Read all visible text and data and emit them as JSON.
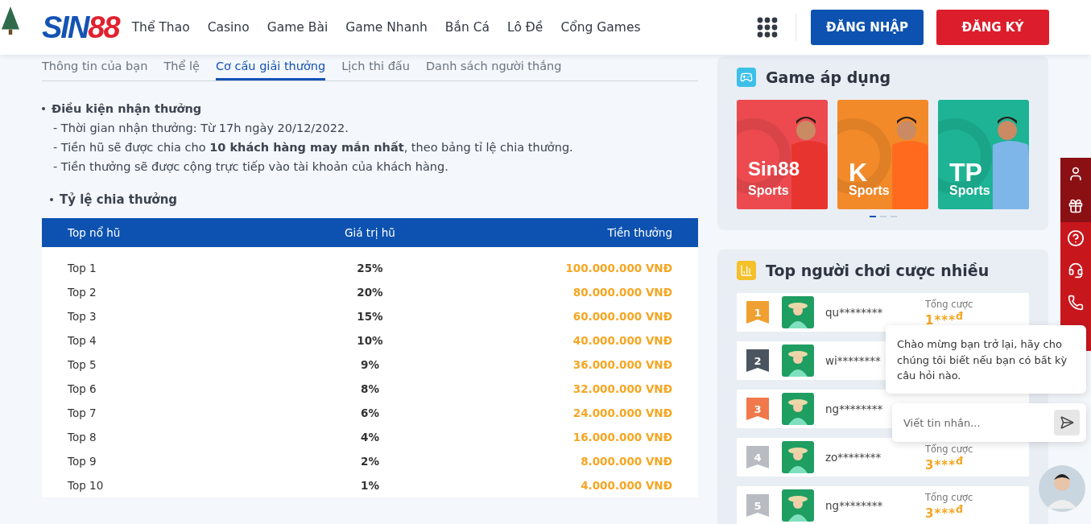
{
  "header": {
    "logo": {
      "part1": "SIN",
      "part2": "88"
    },
    "nav": [
      "Thể Thao",
      "Casino",
      "Game Bài",
      "Game Nhanh",
      "Bắn Cá",
      "Lô Đề",
      "Cổng Games"
    ],
    "login": "ĐĂNG NHẬP",
    "register": "ĐĂNG KÝ"
  },
  "tabs": [
    {
      "label": "Thông tin của bạn",
      "selected": false
    },
    {
      "label": "Thể lệ",
      "selected": false
    },
    {
      "label": "Cơ cấu giải thưởng",
      "selected": true
    },
    {
      "label": "Lịch thi đấu",
      "selected": false
    },
    {
      "label": "Danh sách người thắng",
      "selected": false
    }
  ],
  "conditions": {
    "title": "Điều kiện nhận thưởng",
    "lines": [
      "- Thời gian nhận thưởng: Từ 17h ngày 20/12/2022.",
      "- Tiền hũ sẽ được chia cho **10 khách hàng may mắn nhất**, theo bảng tỉ lệ chia thưởng.",
      "- Tiền thưởng sẽ được cộng trực tiếp vào tài khoản của khách hàng."
    ]
  },
  "ratio_title": "Tỷ lệ chia thưởng",
  "table": {
    "columns": [
      "Top nổ hũ",
      "Giá trị hũ",
      "Tiền thưởng"
    ],
    "rows": [
      [
        "Top 1",
        "25%",
        "100.000.000 VNĐ"
      ],
      [
        "Top 2",
        "20%",
        "80.000.000 VNĐ"
      ],
      [
        "Top 3",
        "15%",
        "60.000.000 VNĐ"
      ],
      [
        "Top 4",
        "10%",
        "40.000.000 VNĐ"
      ],
      [
        "Top 5",
        "9%",
        "36.000.000 VNĐ"
      ],
      [
        "Top 6",
        "8%",
        "32.000.000 VNĐ"
      ],
      [
        "Top 7",
        "6%",
        "24.000.000 VNĐ"
      ],
      [
        "Top 8",
        "4%",
        "16.000.000 VNĐ"
      ],
      [
        "Top 9",
        "2%",
        "8.000.000 VNĐ"
      ],
      [
        "Top 10",
        "1%",
        "4.000.000 VNĐ"
      ]
    ]
  },
  "games": {
    "title": "Game áp dụng",
    "cards": [
      {
        "name": "Sin88",
        "sub": "Sports",
        "color": "#ec4a4f"
      },
      {
        "name": "K",
        "sub": "Sports",
        "color": "#f28a2a"
      },
      {
        "name": "TP",
        "sub": "Sports",
        "color": "#1db394"
      }
    ],
    "dots": [
      {
        "selected": true
      },
      {
        "selected": false
      },
      {
        "selected": false
      }
    ]
  },
  "leaders": {
    "title": "Top người chơi cược nhiều",
    "rows": [
      {
        "rank": "1",
        "color": "#f0a030",
        "name": "qu********",
        "label": "Tổng cược",
        "amount": "1***$^{đ}$"
      },
      {
        "rank": "2",
        "color": "#4a5560",
        "name": "wi********"
      },
      {
        "rank": "3",
        "color": "#f0784a",
        "name": "ng********"
      },
      {
        "rank": "4",
        "color": "#b8bcc2",
        "name": "zo********",
        "label": "Tổng cược",
        "amount": "3***$^{đ}$"
      },
      {
        "rank": "5",
        "color": "#b8bcc2",
        "name": "ng********",
        "label": "Tổng cược",
        "amount": "3***$^{đ}$"
      }
    ]
  },
  "chat": {
    "message": "Chào mừng bạn trở lại, hãy cho chúng tôi biết nếu bạn có bất kỳ câu hỏi nào.",
    "placeholder": "Viết tin nhắn..."
  }
}
